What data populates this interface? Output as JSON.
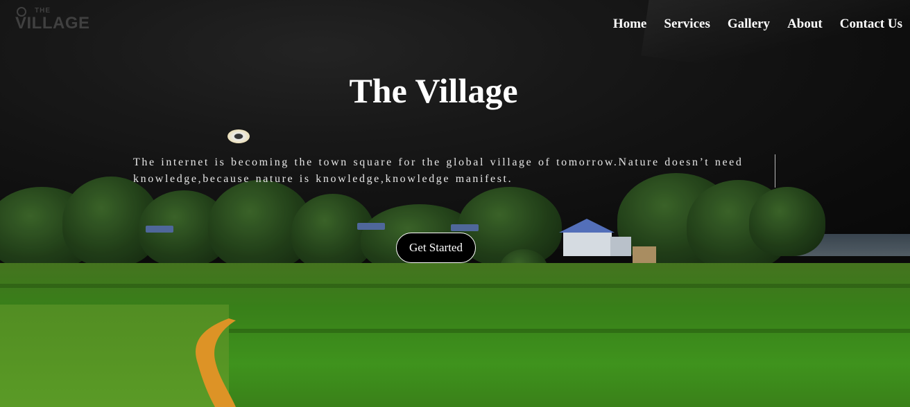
{
  "logo": {
    "small": "THE",
    "word": "VILLAGE"
  },
  "nav": {
    "items": [
      {
        "label": "Home"
      },
      {
        "label": "Services"
      },
      {
        "label": "Gallery"
      },
      {
        "label": "About"
      },
      {
        "label": "Contact Us"
      }
    ]
  },
  "hero": {
    "title": "The Village",
    "tagline": "The internet is becoming the town square for the global village of tomorrow.Nature doesn’t need knowledge,because nature is knowledge,knowledge manifest.",
    "cta_label": "Get Started",
    "background_image": "village-landscape-night-sky-and-green-field"
  },
  "colors": {
    "text": "#ffffff",
    "sky": "#161616",
    "field": "#45a020",
    "button_bg": "#000000"
  }
}
